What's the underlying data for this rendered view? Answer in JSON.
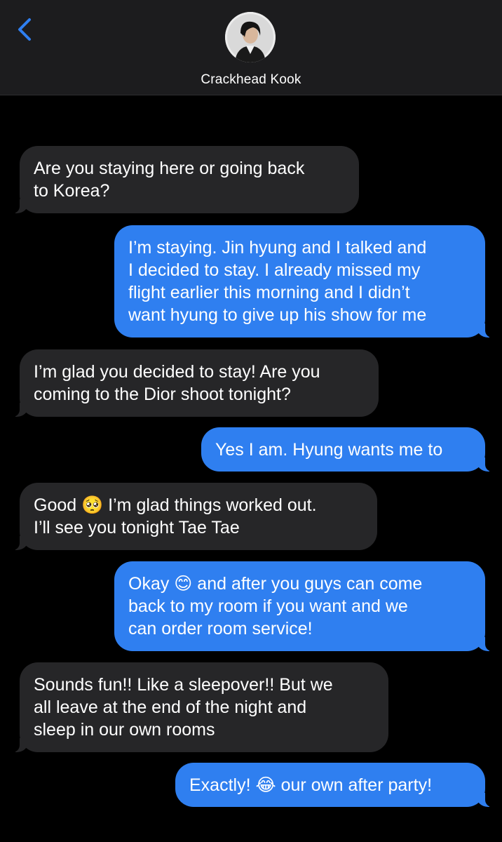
{
  "header": {
    "back_icon": "chevron-left-icon",
    "contact_name": "Crackhead Kook",
    "avatar": "contact-photo"
  },
  "colors": {
    "header_bg": "#1c1c1e",
    "incoming_bubble": "#262628",
    "outgoing_bubble": "#2f7ff0",
    "accent": "#2f7ff0",
    "background": "#000000"
  },
  "messages": [
    {
      "direction": "incoming",
      "lines": [
        "Are you staying here or going back",
        "to Korea?"
      ]
    },
    {
      "direction": "outgoing",
      "lines": [
        "I’m staying. Jin hyung and I talked and",
        "I decided to stay. I already missed my",
        "flight earlier this morning and I didn’t",
        "want hyung to give up his show for me"
      ]
    },
    {
      "direction": "incoming",
      "lines": [
        "I’m glad you decided to stay! Are you",
        "coming to the Dior shoot tonight?"
      ]
    },
    {
      "direction": "outgoing",
      "lines": [
        "Yes I am. Hyung wants me to"
      ]
    },
    {
      "direction": "incoming",
      "lines": [
        "Good 🥺 I’m glad things worked out.",
        "I’ll see you tonight Tae Tae"
      ]
    },
    {
      "direction": "outgoing",
      "lines": [
        "Okay 😊 and after you guys can come",
        "back to my room if you want and we",
        "can order room service!"
      ]
    },
    {
      "direction": "incoming",
      "lines": [
        "Sounds fun!! Like a sleepover!! But we",
        "all leave at the end of the night and",
        "sleep in our own rooms"
      ]
    },
    {
      "direction": "outgoing",
      "lines": [
        "Exactly! 😂 our own after party!"
      ]
    }
  ]
}
